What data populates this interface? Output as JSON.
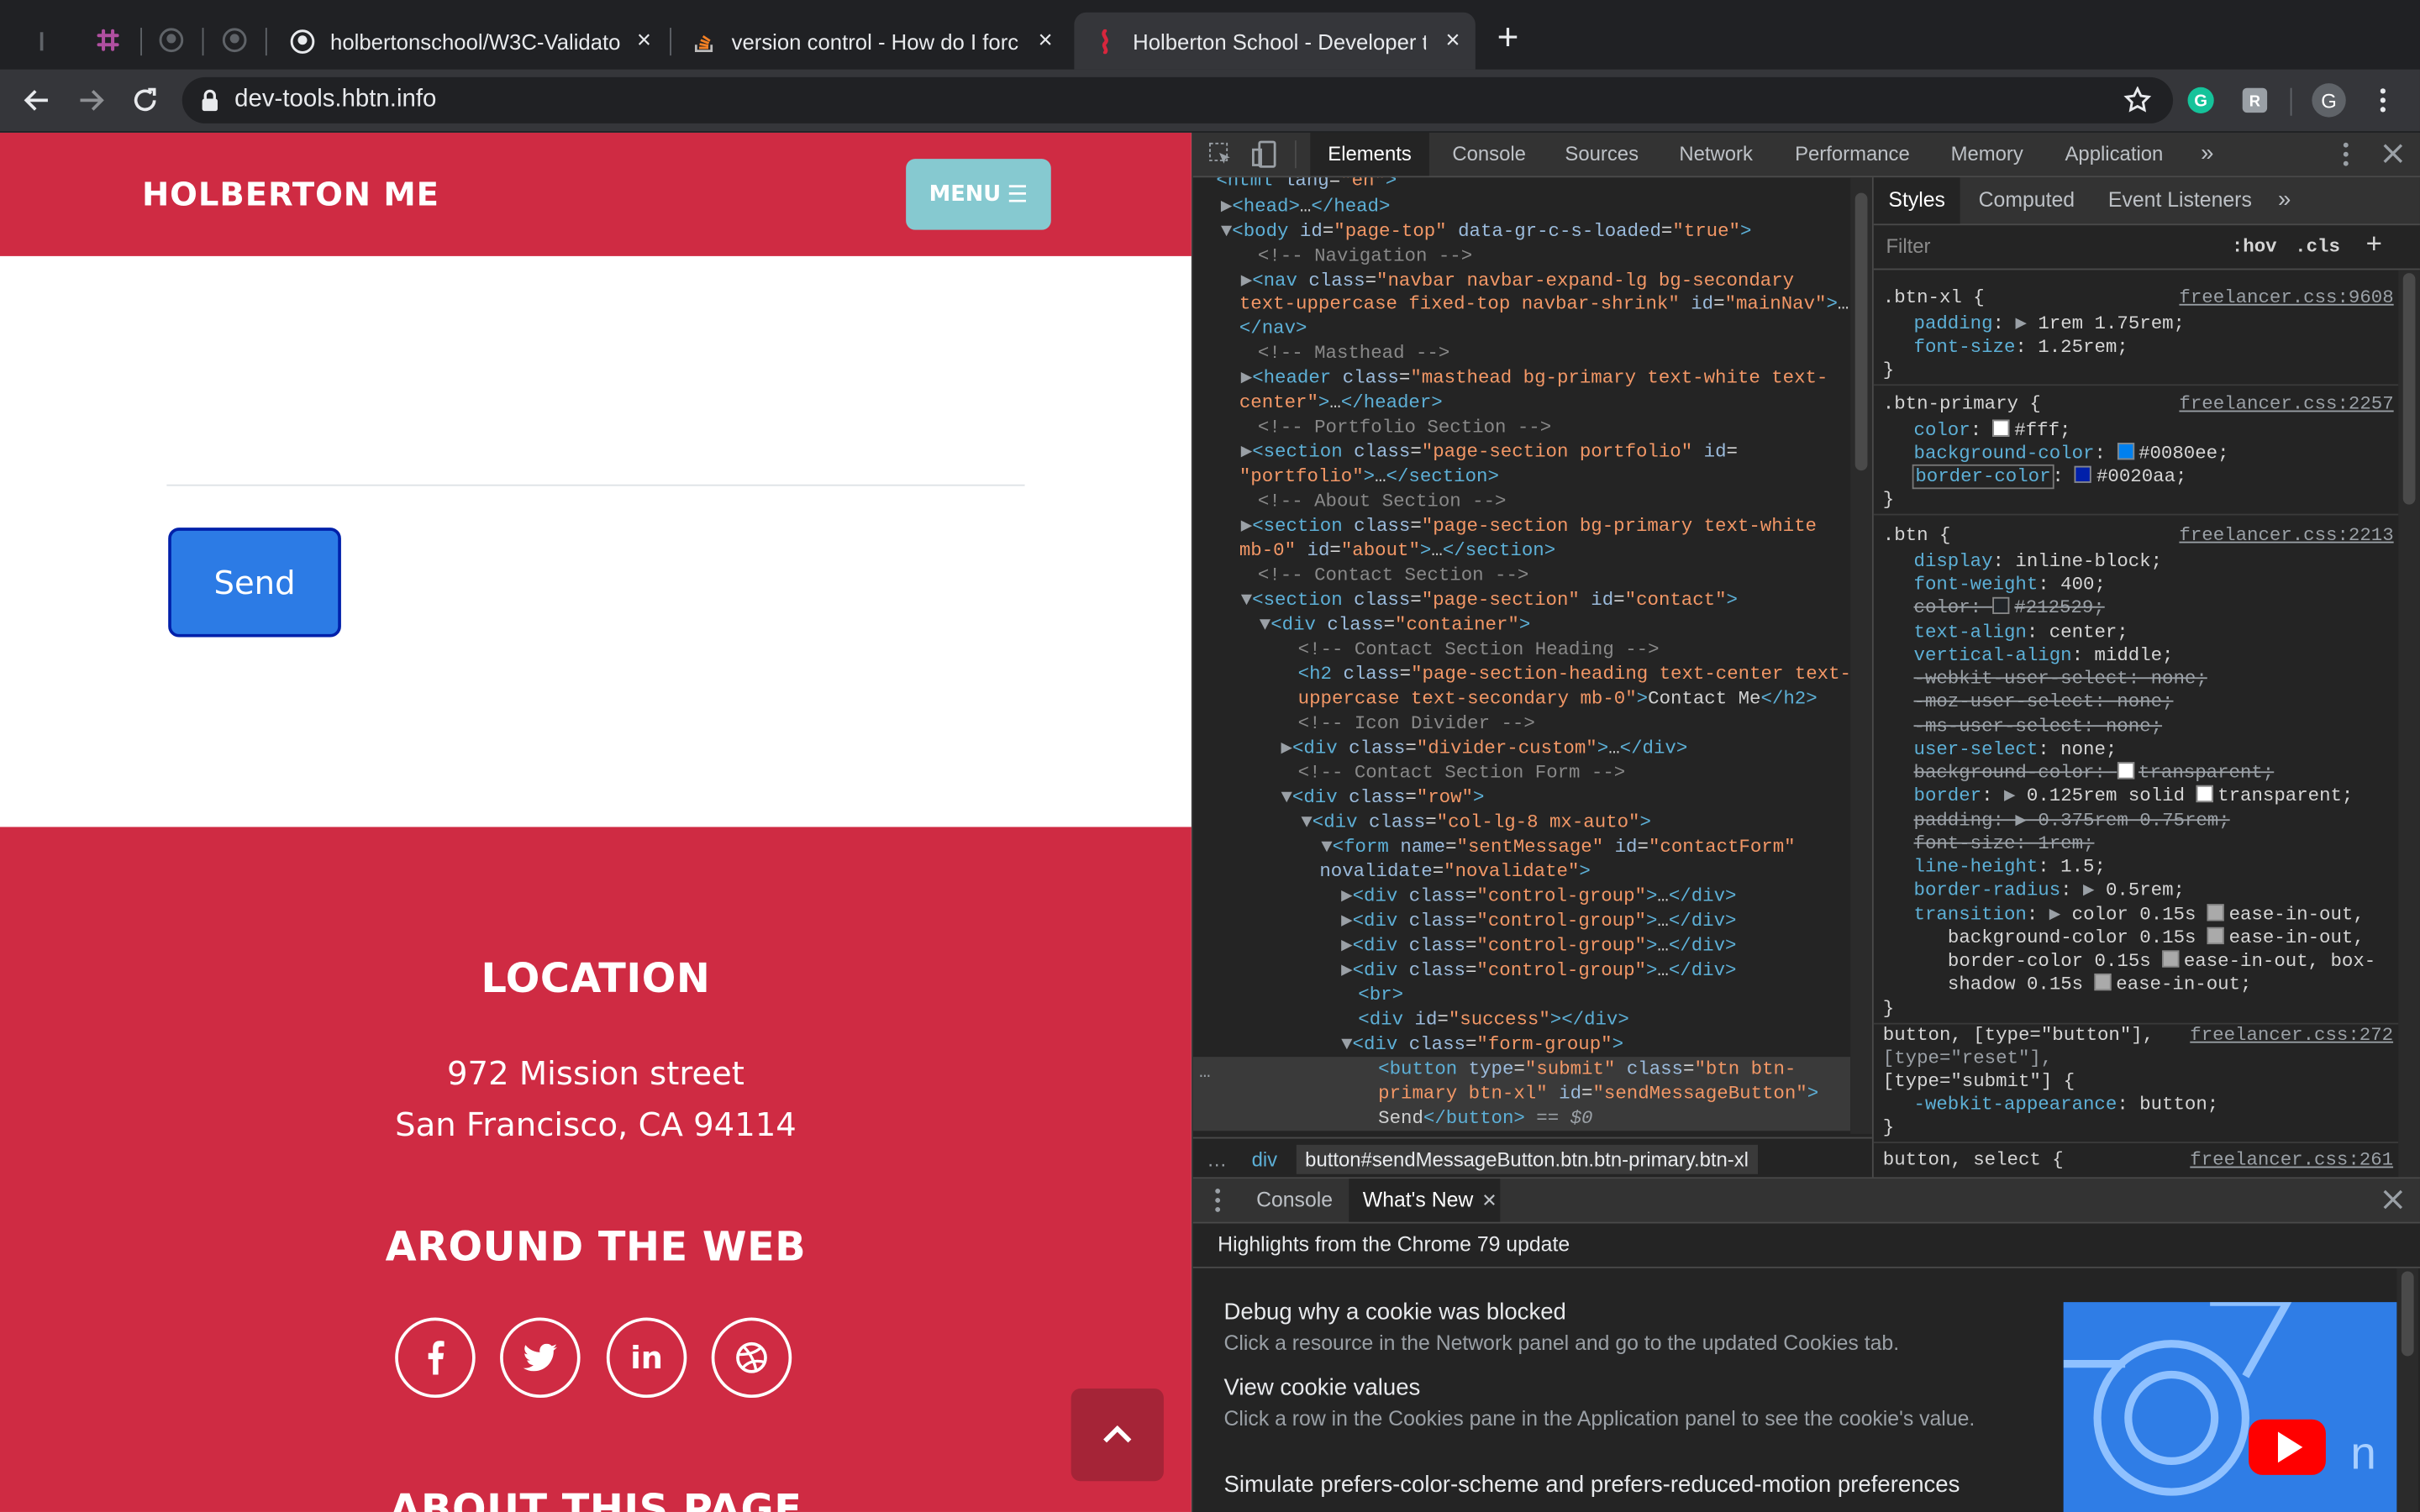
{
  "browser": {
    "tabs": [
      {
        "title": "holbertonschool/W3C-Validato",
        "close": "×"
      },
      {
        "title": "version control - How do I forc",
        "close": "×"
      },
      {
        "title": "Holberton School - Developer t",
        "close": "×"
      }
    ],
    "new_tab": "+",
    "url": "dev-tools.hbtn.info",
    "profile_initial": "G",
    "theme": {
      "red": "#cf2b43",
      "teal": "#86c9d0",
      "blue": "#2c7be5",
      "dark": "#202124"
    }
  },
  "page": {
    "brand": "HOLBERTON ME",
    "menu_label": "MENU",
    "send_label": "Send",
    "location_heading": "LOCATION",
    "address_line1": "972 Mission street",
    "address_line2": "San Francisco, CA 94114",
    "web_heading": "AROUND THE WEB",
    "social": [
      "facebook-icon",
      "twitter-icon",
      "linkedin-icon",
      "dribbble-icon"
    ],
    "linkedin_text": "in",
    "about_heading": "ABOUT THIS PAGE"
  },
  "devtools": {
    "tabs": [
      "Elements",
      "Console",
      "Sources",
      "Network",
      "Performance",
      "Memory",
      "Application"
    ],
    "more": "»",
    "styles_tabs": [
      "Styles",
      "Computed",
      "Event Listeners"
    ],
    "filter_placeholder": "Filter",
    "hov": ":hov",
    "cls": ".cls",
    "breadcrumb": [
      "div",
      "button#sendMessageButton.btn.btn-primary.btn-xl"
    ],
    "drawer_tabs": [
      "Console",
      "What's New"
    ],
    "whats_new_title": "Highlights from the Chrome 79 update",
    "whats_new_items": [
      {
        "title": "Debug why a cookie was blocked",
        "desc": "Click a resource in the Network panel and go to the updated Cookies tab."
      },
      {
        "title": "View cookie values",
        "desc": "Click a row in the Cookies pane in the Application panel to see the cookie's value."
      },
      {
        "title": "Simulate prefers-color-scheme and prefers-reduced-motion preferences",
        "desc": ""
      }
    ],
    "css_rules": [
      {
        "selector": ".btn-xl {",
        "source": "freelancer.css:9608"
      },
      {
        "selector": ".btn-primary {",
        "source": "freelancer.css:2257"
      },
      {
        "selector": ".btn {",
        "source": "freelancer.css:2213"
      },
      {
        "selector": "button, [type=\"button\"],",
        "source": "freelancer.css:272"
      },
      {
        "selector": "button, select {",
        "source": "freelancer.css:261"
      }
    ]
  }
}
